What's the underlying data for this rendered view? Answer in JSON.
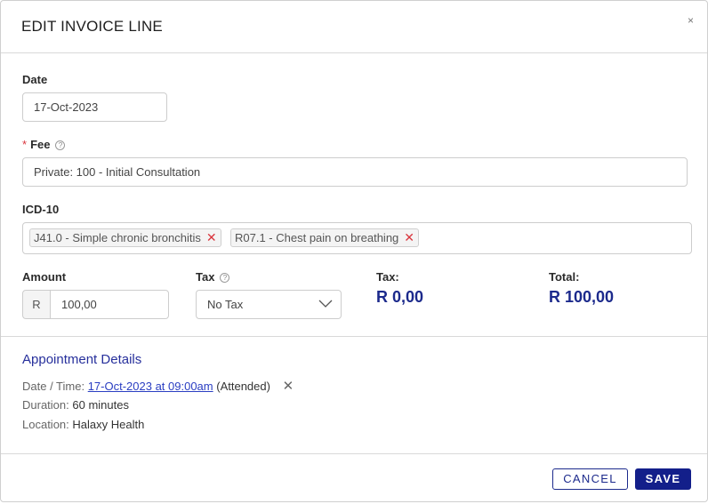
{
  "dialog": {
    "title": "EDIT INVOICE LINE",
    "close_glyph": "×"
  },
  "date": {
    "label": "Date",
    "value": "17-Oct-2023"
  },
  "fee": {
    "required_mark": "*",
    "label": "Fee",
    "help_glyph": "?",
    "value": "Private: 100 - Initial Consultation"
  },
  "icd10": {
    "label": "ICD-10",
    "tags": [
      {
        "text": "J41.0 - Simple chronic bronchitis",
        "remove_glyph": "✕"
      },
      {
        "text": "R07.1 - Chest pain on breathing",
        "remove_glyph": "✕"
      }
    ]
  },
  "amount": {
    "label": "Amount",
    "currency": "R",
    "value": "100,00"
  },
  "tax_select": {
    "label": "Tax",
    "help_glyph": "?",
    "value": "No Tax"
  },
  "tax_total": {
    "label": "Tax:",
    "value": "R 0,00"
  },
  "total": {
    "label": "Total:",
    "value": "R 100,00"
  },
  "appointment": {
    "title": "Appointment Details",
    "datetime_label": "Date / Time:",
    "datetime_link": "17-Oct-2023 at 09:00am",
    "status": "(Attended)",
    "remove_glyph": "✕",
    "duration_label": "Duration:",
    "duration_value": "60 minutes",
    "location_label": "Location:",
    "location_value": "Halaxy Health"
  },
  "footer": {
    "cancel_label": "CANCEL",
    "save_label": "SAVE"
  },
  "colors": {
    "accent": "#1c2a8c",
    "link": "#2a3ec2",
    "danger": "#d9363e"
  }
}
